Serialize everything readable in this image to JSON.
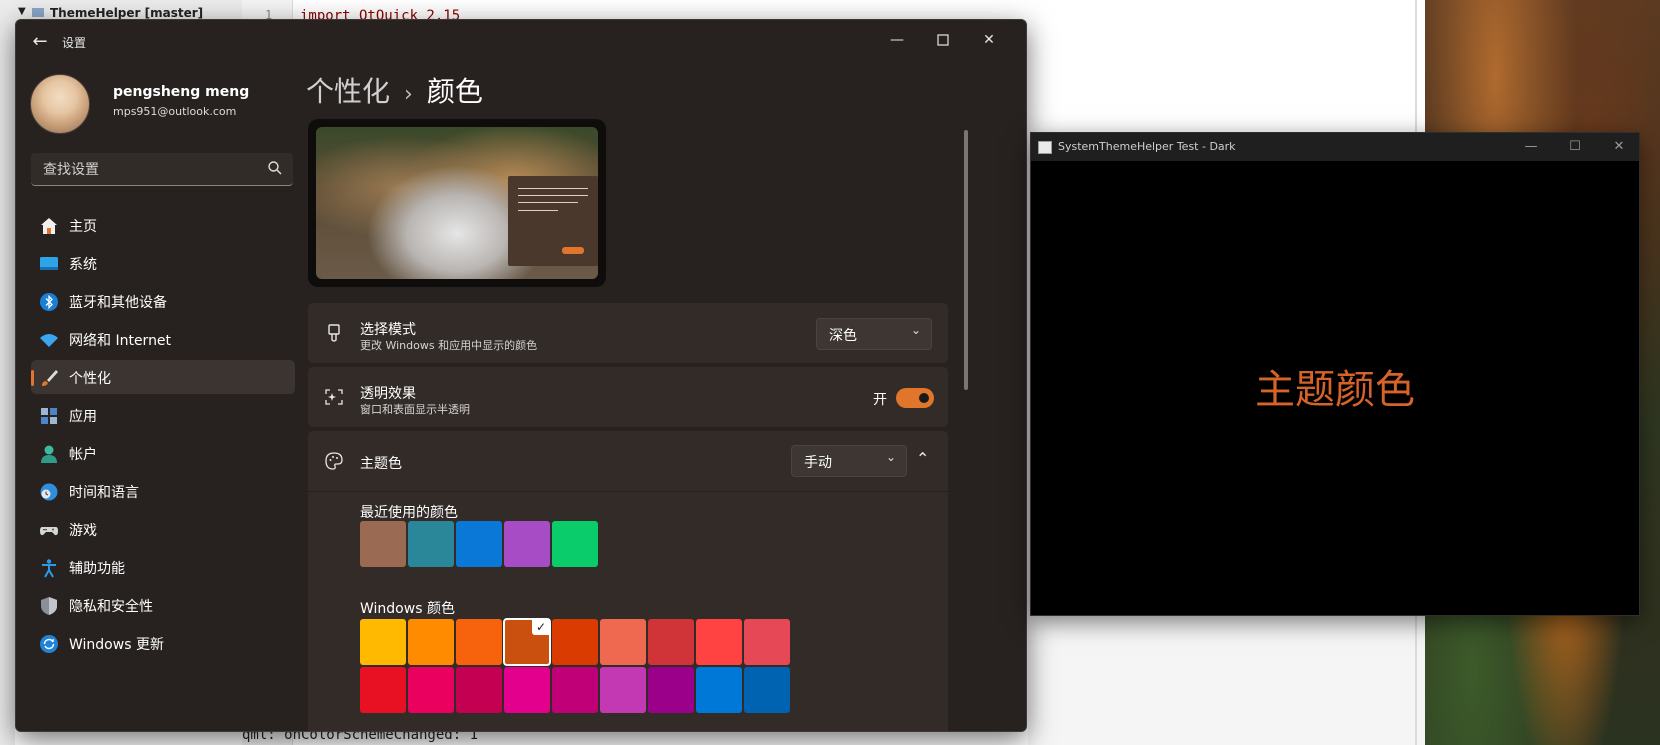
{
  "ide": {
    "project_label": "ThemeHelper [master]",
    "line_number": "1",
    "code_line": "import QtQuick 2.15",
    "console_line": "qml: onColorSchemeChanged: 1"
  },
  "settings": {
    "title": "设置",
    "user": {
      "name": "pengsheng meng",
      "email": "mps951@outlook.com"
    },
    "search": {
      "placeholder": "查找设置"
    },
    "nav": [
      {
        "label": "主页",
        "icon": "home-icon"
      },
      {
        "label": "系统",
        "icon": "system-icon"
      },
      {
        "label": "蓝牙和其他设备",
        "icon": "bluetooth-icon"
      },
      {
        "label": "网络和 Internet",
        "icon": "wifi-icon"
      },
      {
        "label": "个性化",
        "icon": "brush-icon",
        "active": true
      },
      {
        "label": "应用",
        "icon": "apps-icon"
      },
      {
        "label": "帐户",
        "icon": "account-icon"
      },
      {
        "label": "时间和语言",
        "icon": "globe-clock-icon"
      },
      {
        "label": "游戏",
        "icon": "gamepad-icon"
      },
      {
        "label": "辅助功能",
        "icon": "accessibility-icon"
      },
      {
        "label": "隐私和安全性",
        "icon": "shield-icon"
      },
      {
        "label": "Windows 更新",
        "icon": "update-icon"
      }
    ],
    "breadcrumb": {
      "parent": "个性化",
      "separator": "›",
      "current": "颜色"
    },
    "mode_card": {
      "title": "选择模式",
      "subtitle": "更改 Windows 和应用中显示的颜色",
      "value": "深色"
    },
    "transparency_card": {
      "title": "透明效果",
      "subtitle": "窗口和表面显示半透明",
      "state_label": "开",
      "enabled": true
    },
    "accent_card": {
      "title": "主题色",
      "value": "手动",
      "recent_label": "最近使用的颜色",
      "recent_colors": [
        "#9a6a52",
        "#2a8799",
        "#0a78d6",
        "#a84cc5",
        "#0acc6a"
      ],
      "windows_label": "Windows 颜色",
      "windows_colors_row1": [
        "#ffb900",
        "#ff8c00",
        "#f7630c",
        "#ca5010",
        "#da3b01",
        "#ef6950",
        "#d13438",
        "#ff4343",
        "#e74856"
      ],
      "windows_colors_row2": [
        "#e81123",
        "#ea005e",
        "#c30052",
        "#e3008c",
        "#bf0077",
        "#c239b3",
        "#9a0089",
        "#0078d7",
        "#0063b1"
      ],
      "selected_index": 3
    },
    "accent": "#e0752b"
  },
  "test_window": {
    "title": "SystemThemeHelper Test - Dark",
    "text": "主题颜色",
    "text_color": "#d6632a"
  }
}
